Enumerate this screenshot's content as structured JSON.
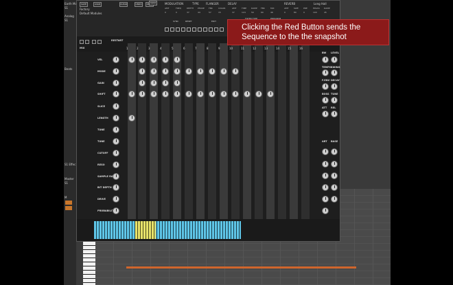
{
  "daw": {
    "track_labels": [
      "Earth Ma",
      "S1",
      "Analog",
      "S1",
      "Beats",
      "S1 Effec",
      "Master",
      "S1",
      "M"
    ]
  },
  "plugin": {
    "top_buttons": [
      "SAVE",
      "LOAD",
      "CLEAR",
      "UNDO",
      "REDO",
      "SWAP"
    ],
    "presets": [
      "Factory",
      "Default Modules"
    ],
    "sections": [
      "MODULATION",
      "TYPE",
      "FLANGER",
      "DELAY",
      "REVERB",
      "Long Hall"
    ],
    "param_labels": [
      "AMT",
      "FREQ",
      "DEPTH",
      "PHASE",
      "FBK",
      "COLOR",
      "AMT",
      "TIME",
      "DAMP",
      "FBK",
      "MIX",
      "AMT",
      "SIZE",
      "PRE",
      "HPASS",
      "DAMP"
    ],
    "param_values": [
      "0",
      "0",
      "37",
      "44",
      "57",
      "15",
      "37",
      "124",
      "50",
      "60",
      "46",
      "0",
      "80",
      "0",
      "100",
      "45"
    ],
    "filter_type_label": "FILTER TYPE",
    "program_label": "PROGRAM",
    "restart_label": "RESTART",
    "step_controls": [
      "SYNC",
      "RESET",
      "EDIT"
    ],
    "mix_label": "MIX",
    "mix_values": [
      "Fast",
      "Slow",
      "1/1"
    ],
    "step_numbers": [
      "1",
      "2",
      "3",
      "4",
      "5",
      "6",
      "7",
      "8",
      "9",
      "10",
      "11",
      "12",
      "13",
      "14",
      "15",
      "16"
    ],
    "rows": [
      "VEL",
      "MODE",
      "GAIN",
      "SHIFT",
      "SLICE",
      "LENGTH",
      "TUNE",
      "TUNE",
      "CUTOFF",
      "RESO",
      "SAMPLE RATE",
      "BIT DEPTH",
      "DRIVE",
      "PROBABILITY"
    ],
    "right_labels": [
      "BW",
      "LEVEL",
      "TEMPO",
      "SWING",
      "F.ENV",
      "DECAY",
      "BOSS",
      "TUNE",
      "ATT",
      "REL",
      "ART",
      "BASE"
    ]
  },
  "callout": {
    "line1": "Clicking the Red Button sends the",
    "line2": "Sequence to the the snapshot"
  }
}
